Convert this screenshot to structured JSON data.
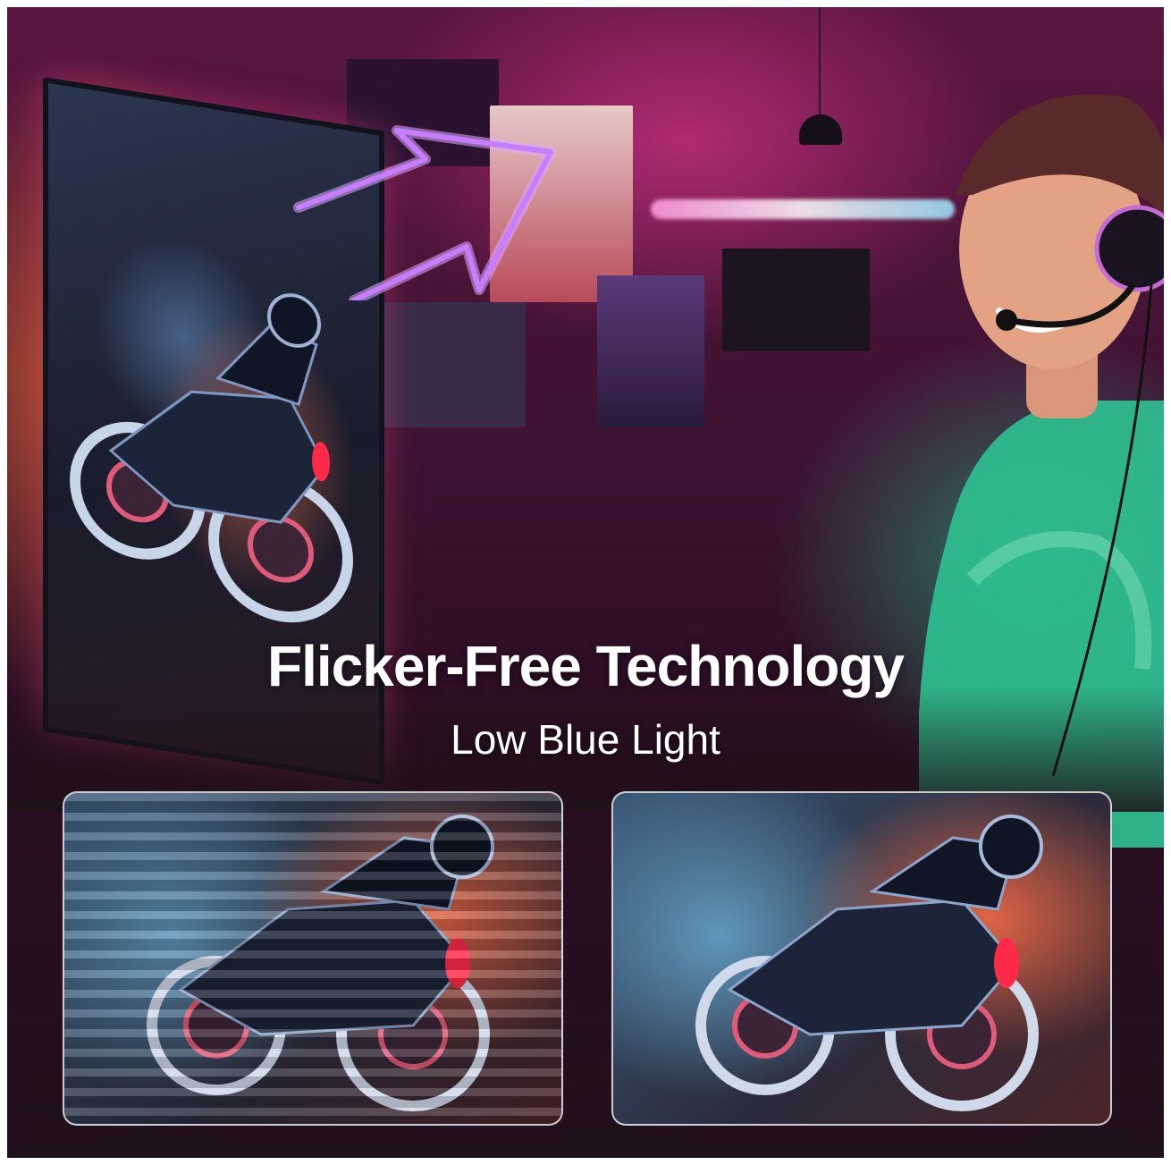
{
  "headline": "Flicker-Free Technology",
  "subheadline": "Low Blue Light",
  "colors": {
    "neon_arrow": "#c77dff",
    "ambient_pink": "#ff3c9c",
    "sweater_green": "#2fbf8f"
  },
  "panels": {
    "left": {
      "icon": "motorcycle-rider-icon",
      "state": "flickering"
    },
    "right": {
      "icon": "motorcycle-rider-icon",
      "state": "flicker-free"
    }
  }
}
